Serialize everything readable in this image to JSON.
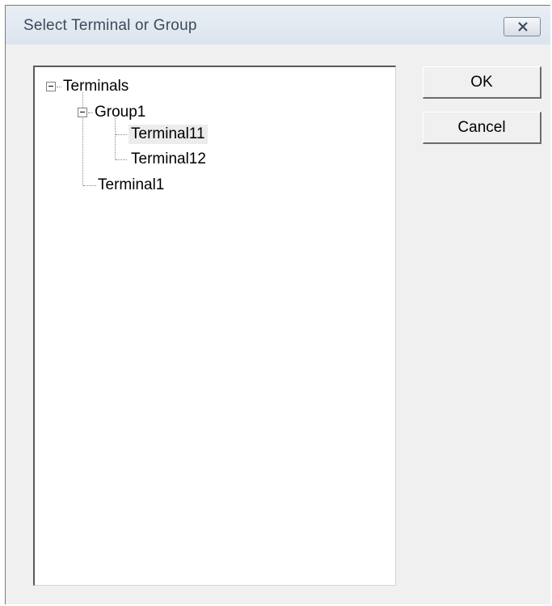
{
  "dialog": {
    "title": "Select Terminal or Group"
  },
  "tree": {
    "root_label": "Terminals",
    "group_label": "Group1",
    "group_children": [
      "Terminal11",
      "Terminal12"
    ],
    "root_child_label": "Terminal1",
    "selected": "Terminal11"
  },
  "buttons": {
    "ok_label": "OK",
    "cancel_label": "Cancel"
  },
  "icons": {
    "close": "close-icon",
    "collapse": "collapse-icon"
  }
}
